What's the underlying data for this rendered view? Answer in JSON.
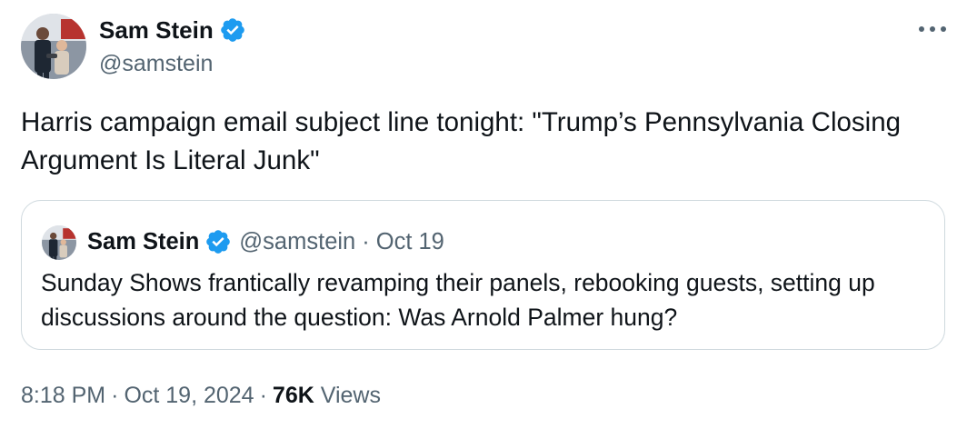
{
  "author": {
    "display_name": "Sam Stein",
    "handle": "@samstein",
    "verified": true,
    "avatar_icon": "profile-photo"
  },
  "tweet": {
    "text": "Harris campaign email subject line tonight: \"Trump’s Pennsylvania Closing Argument Is Literal Junk\""
  },
  "quoted_tweet": {
    "display_name": "Sam Stein",
    "handle": "@samstein",
    "separator": "·",
    "date": "Oct 19",
    "text": "Sunday Shows frantically revamping their panels, rebooking guests, setting up discussions around the question: Was Arnold Palmer hung?"
  },
  "meta": {
    "time": "8:18 PM",
    "separator": "·",
    "date": "Oct 19, 2024",
    "views_count": "76K",
    "views_label": "Views"
  },
  "colors": {
    "text": "#0f1419",
    "secondary": "#536471",
    "verified_badge": "#1d9bf0",
    "border": "#cfd9de"
  },
  "icons": {
    "verified": "verified-badge-icon",
    "more": "more-options-icon"
  }
}
